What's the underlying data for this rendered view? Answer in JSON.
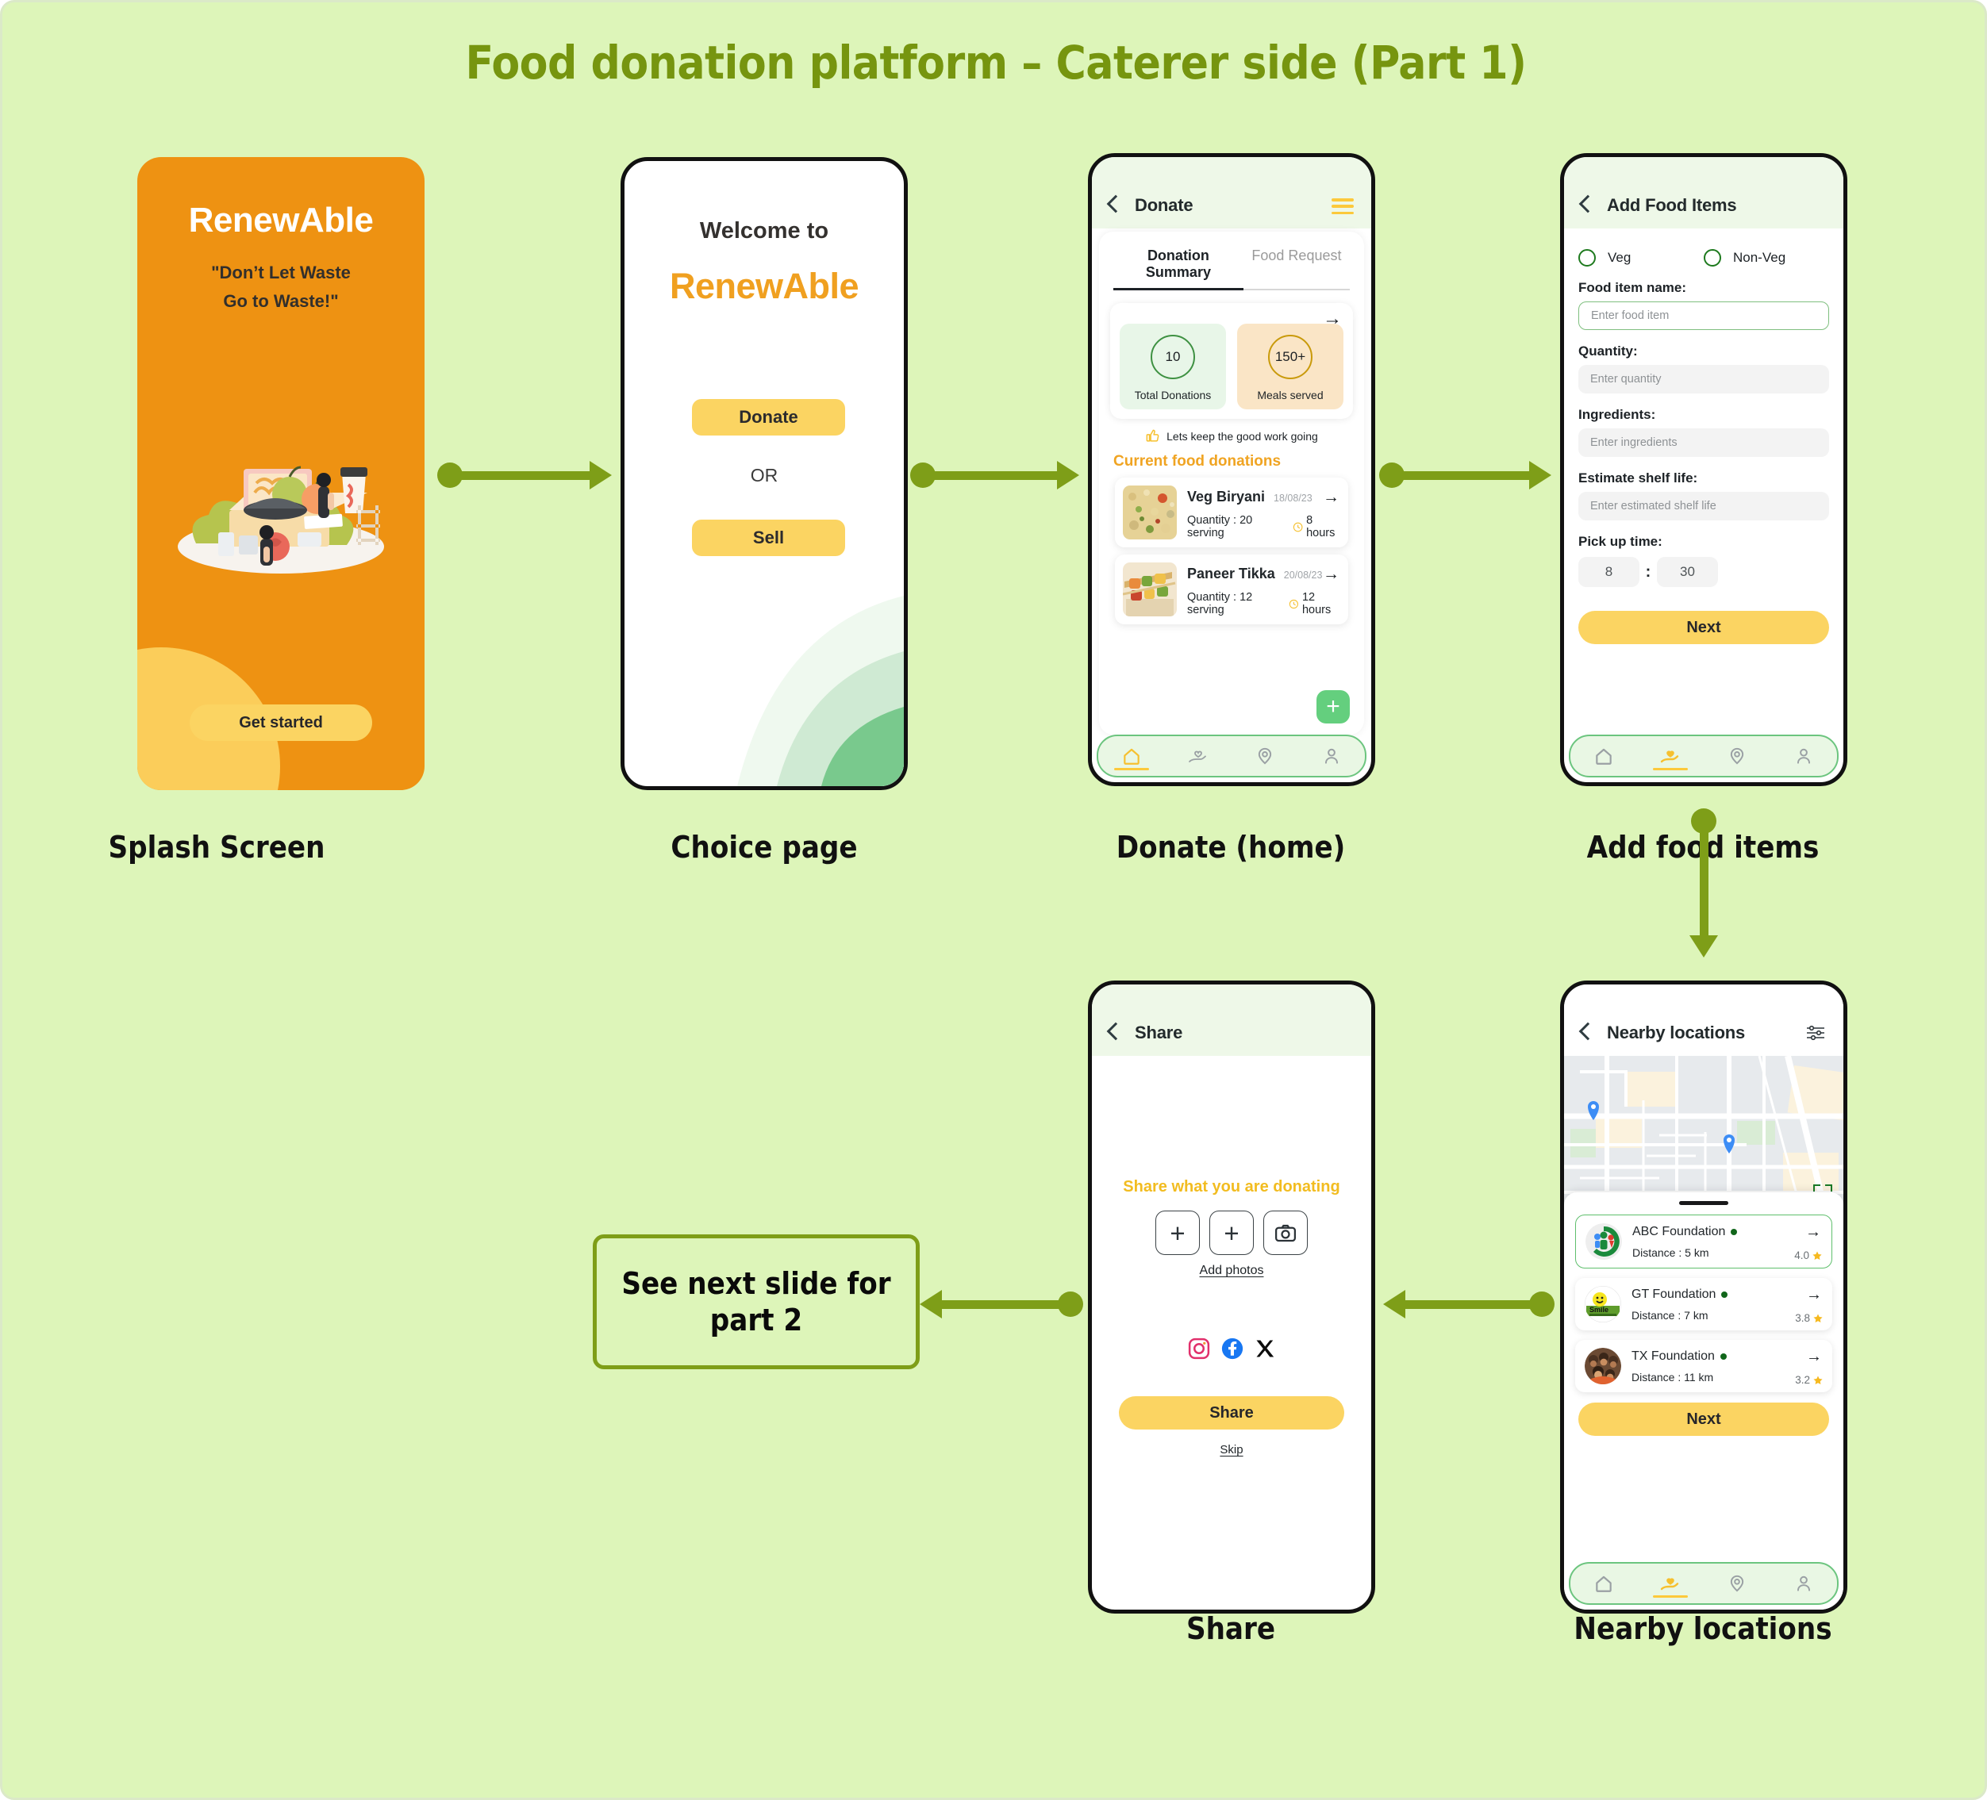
{
  "board": {
    "title": "Food donation platform  – Caterer side (Part 1)",
    "bg_color": "#ddf5b9",
    "accent_olive": "#7e9e18",
    "accent_orange": "#ee9212",
    "accent_yellow": "#fbd462",
    "accent_green": "#64cf7e"
  },
  "captions": {
    "splash": "Splash Screen",
    "choice": "Choice page",
    "donate": "Donate (home)",
    "addfood": "Add food items",
    "share": "Share",
    "nearby": "Nearby locations"
  },
  "note": {
    "text": "See next slide for part 2"
  },
  "splash": {
    "brand": "RenewAble",
    "quote_line1": "\"Don’t Let Waste",
    "quote_line2": "Go to Waste!\"",
    "cta": "Get started",
    "illustration_name": "food-donation-illustration"
  },
  "choice": {
    "welcome": "Welcome to",
    "brand": "RenewAble",
    "donate_label": "Donate",
    "or_label": "OR",
    "sell_label": "Sell"
  },
  "donate": {
    "header_title": "Donate",
    "back_icon": "chevron-left-icon",
    "menu_icon": "hamburger-menu-icon",
    "tabs": [
      {
        "label": "Donation Summary",
        "active": true
      },
      {
        "label": "Food Request",
        "active": false
      }
    ],
    "stats_arrow_icon": "arrow-right-icon",
    "stats": [
      {
        "value": "10",
        "label": "Total Donations",
        "tone": "green"
      },
      {
        "value": "150+",
        "label": "Meals served",
        "tone": "orange"
      }
    ],
    "encouragement": {
      "icon": "thumbs-up-icon",
      "text": "Lets keep the good work going"
    },
    "donations_heading": "Current food donations",
    "items": [
      {
        "name": "Veg Biryani",
        "date": "18/08/23",
        "quantity": "Quantity : 20 serving",
        "shelf": "8 hours",
        "clock_icon": "clock-icon",
        "arrow_icon": "arrow-right-icon",
        "thumb_name": "veg-biryani-photo"
      },
      {
        "name": "Paneer Tikka",
        "date": "20/08/23",
        "quantity": "Quantity : 12 serving",
        "shelf": "12 hours",
        "clock_icon": "clock-icon",
        "arrow_icon": "arrow-right-icon",
        "thumb_name": "paneer-tikka-photo"
      }
    ],
    "fab_label": "+",
    "nav": [
      {
        "icon": "home-icon",
        "active": true
      },
      {
        "icon": "hand-heart-icon",
        "active": false
      },
      {
        "icon": "location-pin-icon",
        "active": false
      },
      {
        "icon": "person-icon",
        "active": false
      }
    ]
  },
  "addfood": {
    "header_title": "Add Food Items",
    "back_icon": "chevron-left-icon",
    "diet_options": [
      {
        "label": "Veg",
        "selected": false
      },
      {
        "label": "Non-Veg",
        "selected": false
      }
    ],
    "fields": [
      {
        "label": "Food item name:",
        "placeholder": "Enter food item",
        "value": "",
        "focused": true
      },
      {
        "label": "Quantity:",
        "placeholder": "Enter quantity",
        "value": "",
        "focused": false
      },
      {
        "label": "Ingredients:",
        "placeholder": "Enter ingredients",
        "value": "",
        "focused": false
      },
      {
        "label": "Estimate shelf life:",
        "placeholder": "Enter estimated shelf life",
        "value": "",
        "focused": false
      }
    ],
    "pickup_label": "Pick up time:",
    "pickup_hour": "8",
    "pickup_separator": ":",
    "pickup_minute": "30",
    "next_label": "Next",
    "nav": [
      {
        "icon": "home-icon",
        "active": false
      },
      {
        "icon": "hand-heart-icon",
        "active": true
      },
      {
        "icon": "location-pin-icon",
        "active": false
      },
      {
        "icon": "person-icon",
        "active": false
      }
    ]
  },
  "share": {
    "header_title": "Share",
    "back_icon": "chevron-left-icon",
    "prompt": "Share what you are donating",
    "boxes": [
      {
        "icon": "plus-icon",
        "label": "+"
      },
      {
        "icon": "plus-icon",
        "label": "+"
      },
      {
        "icon": "camera-icon",
        "label": ""
      }
    ],
    "add_photos_label": "Add photos",
    "socials": [
      {
        "icon": "instagram-icon",
        "color": "#E1306C"
      },
      {
        "icon": "facebook-icon",
        "color": "#1877F2"
      },
      {
        "icon": "x-twitter-icon",
        "color": "#000000"
      }
    ],
    "share_label": "Share",
    "skip_label": "Skip"
  },
  "nearby": {
    "header_title": "Nearby locations",
    "back_icon": "chevron-left-icon",
    "filter_icon": "filter-sliders-icon",
    "map": {
      "pins": [
        {
          "icon": "map-pin-icon"
        },
        {
          "icon": "map-pin-icon"
        }
      ],
      "crosshair_icon": "focus-frame-icon"
    },
    "locations": [
      {
        "name": "ABC Foundation",
        "status_dot": "#11661b",
        "distance": "Distance : 5 km",
        "rating": "4.0",
        "star_icon": "star-icon",
        "arrow_icon": "arrow-right-icon",
        "avatar_name": "abc-foundation-logo",
        "selected": true
      },
      {
        "name": "GT Foundation",
        "status_dot": "#11661b",
        "distance": "Distance : 7 km",
        "rating": "3.8",
        "star_icon": "star-icon",
        "arrow_icon": "arrow-right-icon",
        "avatar_name": "gt-foundation-logo",
        "selected": false
      },
      {
        "name": "TX Foundation",
        "status_dot": "#11661b",
        "distance": "Distance : 11 km",
        "rating": "3.2",
        "star_icon": "star-icon",
        "arrow_icon": "arrow-right-icon",
        "avatar_name": "tx-foundation-photo",
        "selected": false
      }
    ],
    "next_label": "Next",
    "nav": [
      {
        "icon": "home-icon",
        "active": false
      },
      {
        "icon": "hand-heart-icon",
        "active": true
      },
      {
        "icon": "location-pin-icon",
        "active": false
      },
      {
        "icon": "person-icon",
        "active": false
      }
    ]
  }
}
